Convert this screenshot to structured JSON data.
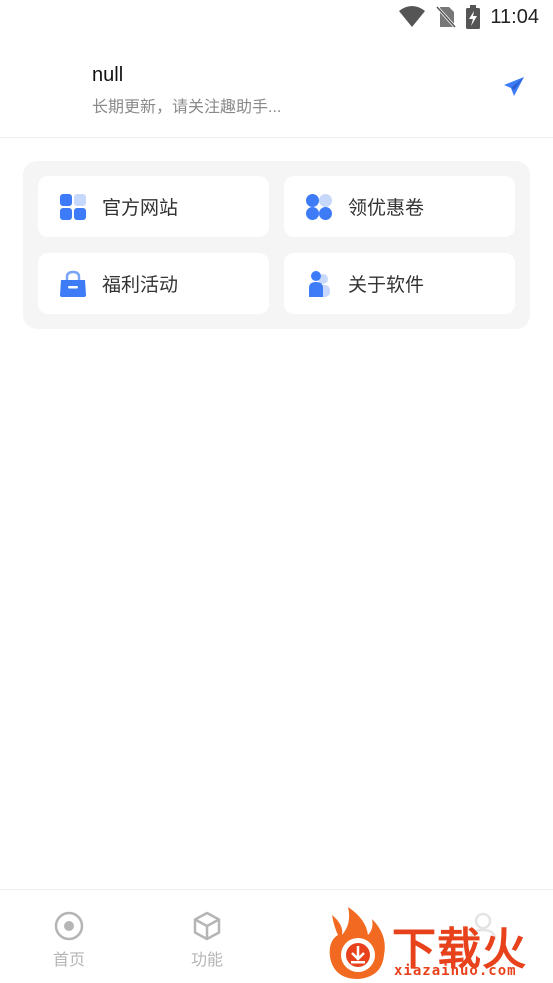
{
  "status_bar": {
    "time": "11:04",
    "icons": [
      "wifi-icon",
      "no-sim-icon",
      "battery-charging-icon"
    ]
  },
  "header": {
    "title": "null",
    "subtitle": "长期更新，请关注趣助手...",
    "action_icon": "send-icon",
    "accent_color": "#3d7bf7"
  },
  "grid": {
    "items": [
      {
        "label": "官方网站",
        "icon": "grid-apps-icon"
      },
      {
        "label": "领优惠卷",
        "icon": "clover-icon"
      },
      {
        "label": "福利活动",
        "icon": "shopping-bag-icon"
      },
      {
        "label": "关于软件",
        "icon": "user-icon"
      }
    ]
  },
  "bottom_nav": {
    "items": [
      {
        "label": "首页",
        "icon": "target-icon"
      },
      {
        "label": "功能",
        "icon": "cube-icon"
      },
      {
        "label": "",
        "icon": "user-icon"
      }
    ]
  },
  "watermark": {
    "brand": "下载火",
    "url": "xiazaihuo.com",
    "color": "#e8421c"
  }
}
